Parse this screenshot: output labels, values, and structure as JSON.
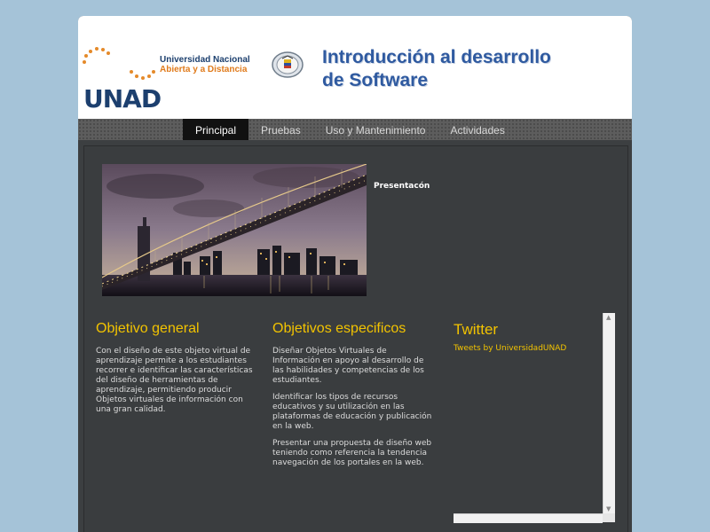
{
  "header": {
    "logo_text": "UNAD",
    "university_line1": "Universidad Nacional",
    "university_line2": "Abierta y a Distancia",
    "course_title_line1": "Introducción al desarrollo",
    "course_title_line2": "de Software"
  },
  "nav": {
    "items": [
      {
        "label": "Principal"
      },
      {
        "label": "Pruebas"
      },
      {
        "label": "Uso y Mantenimiento"
      },
      {
        "label": "Actividades"
      }
    ]
  },
  "main": {
    "presentacion": "Presentacón",
    "objetivo_general": {
      "title": "Objetivo general",
      "text": "Con el diseño de este objeto virtual de aprendizaje permite a los estudiantes recorrer e identificar las características del diseño de herramientas de aprendizaje, permitiendo producir Objetos virtuales de información con una gran calidad."
    },
    "objetivos_especificos": {
      "title": "Objetivos especificos",
      "items": [
        "Diseñar Objetos Virtuales de Información en apoyo al desarrollo de las habilidades y competencias de los estudiantes.",
        "Identificar los tipos de recursos educativos y su utilización en las plataformas de educación y publicación en la web.",
        "Presentar una propuesta de diseño web teniendo como referencia la tendencia navegación  de los portales en la web."
      ]
    },
    "twitter": {
      "title": "Twitter",
      "link": "Tweets by UniversidadUNAD"
    }
  },
  "colors": {
    "background": "#a5c3d8",
    "content_bg": "#3a3d3f",
    "accent_yellow": "#f2c300",
    "title_blue": "#2f5aa0",
    "unad_orange": "#e07b1c"
  }
}
